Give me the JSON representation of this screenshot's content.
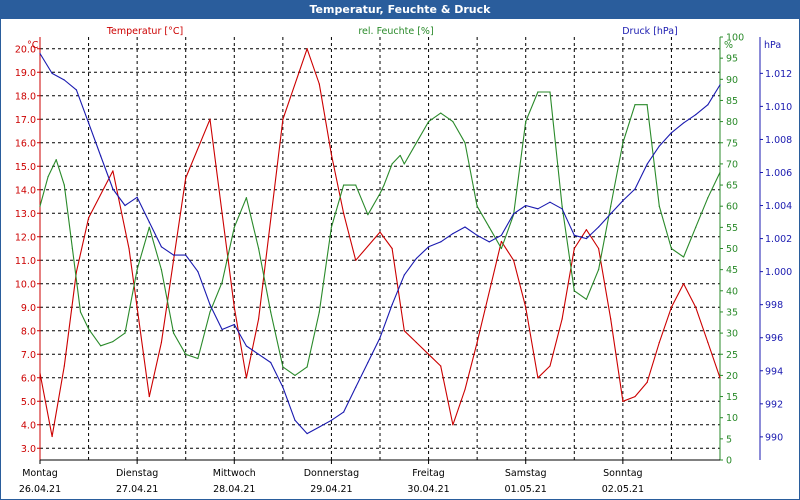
{
  "chart_data": {
    "type": "line",
    "title": "Temperatur, Feuchte & Druck",
    "x_range": [
      "2021-04-26 00:00",
      "2021-05-03 00:00"
    ],
    "x_ticks": [
      {
        "day": "Montag",
        "date": "26.04.21"
      },
      {
        "day": "Dienstag",
        "date": "27.04.21"
      },
      {
        "day": "Mittwoch",
        "date": "28.04.21"
      },
      {
        "day": "Donnerstag",
        "date": "29.04.21"
      },
      {
        "day": "Freitag",
        "date": "30.04.21"
      },
      {
        "day": "Samstag",
        "date": "01.05.21"
      },
      {
        "day": "Sonntag",
        "date": "02.05.21"
      }
    ],
    "grid": true,
    "axes": {
      "temperature": {
        "label": "Temperatur [°C]",
        "unit": "°C",
        "ylim": [
          2.5,
          20.5
        ],
        "ticks": [
          "20.0",
          "19.0",
          "18.0",
          "17.0",
          "16.0",
          "15.0",
          "14.0",
          "13.0",
          "12.0",
          "11.0",
          "10.0",
          "9.0",
          "8.0",
          "7.0",
          "6.0",
          "5.0",
          "4.0",
          "3.0"
        ],
        "color": "#cc0000"
      },
      "humidity": {
        "label": "rel. Feuchte [%]",
        "unit": "%",
        "ylim": [
          0,
          100
        ],
        "ticks": [
          "100",
          "95",
          "90",
          "85",
          "80",
          "75",
          "70",
          "65",
          "60",
          "55",
          "50",
          "45",
          "40",
          "35",
          "30",
          "25",
          "20",
          "15",
          "10",
          "5",
          "0"
        ],
        "color": "#2a8a2a"
      },
      "pressure": {
        "label": "Druck [hPa]",
        "unit": "hPa",
        "ylim": [
          988.6,
          1014.2
        ],
        "ticks": [
          "1.012",
          "1.010",
          "1.008",
          "1.006",
          "1.004",
          "1.002",
          "1.000",
          "998",
          "996",
          "994",
          "992",
          "990"
        ],
        "color": "#1a1ab0"
      }
    },
    "series": [
      {
        "name": "Temperatur [°C]",
        "axis": "temperature",
        "x_hours": [
          0,
          3,
          6,
          9,
          12,
          18,
          22,
          24,
          27,
          30,
          36,
          42,
          45,
          48,
          51,
          54,
          60,
          66,
          69,
          72,
          75,
          78,
          84,
          87,
          90,
          93,
          96,
          99,
          102,
          105,
          108,
          114,
          117,
          120,
          123,
          126,
          129,
          132,
          135,
          138,
          141,
          144,
          147,
          150,
          153,
          156,
          159,
          162,
          165,
          168
        ],
        "values": [
          6.2,
          3.5,
          6.5,
          10.5,
          12.8,
          14.8,
          11.5,
          9.0,
          5.2,
          7.5,
          14.5,
          17.0,
          13.0,
          9.0,
          6.0,
          8.5,
          17.0,
          20.0,
          18.5,
          15.5,
          13.0,
          11.0,
          12.2,
          11.5,
          8.0,
          7.5,
          7.0,
          6.5,
          4.0,
          5.5,
          7.5,
          11.8,
          11.0,
          9.0,
          6.0,
          6.5,
          8.5,
          11.5,
          12.3,
          11.5,
          8.5,
          5.0,
          5.2,
          5.8,
          7.5,
          9.0,
          10.0,
          9.0,
          7.5,
          6.0
        ]
      },
      {
        "name": "rel. Feuchte [%]",
        "axis": "humidity",
        "x_hours": [
          0,
          2,
          4,
          6,
          8,
          10,
          12,
          15,
          18,
          21,
          24,
          27,
          30,
          33,
          36,
          39,
          42,
          45,
          48,
          51,
          54,
          57,
          60,
          63,
          66,
          69,
          72,
          75,
          78,
          81,
          84,
          85,
          87,
          89,
          90,
          93,
          96,
          99,
          102,
          105,
          108,
          111,
          114,
          117,
          120,
          123,
          126,
          129,
          132,
          135,
          138,
          141,
          144,
          147,
          150,
          153,
          156,
          159,
          162,
          165,
          168
        ],
        "values": [
          60,
          67,
          71,
          65,
          50,
          35,
          31,
          27,
          28,
          30,
          45,
          55,
          45,
          30,
          25,
          24,
          35,
          42,
          55,
          62,
          50,
          35,
          22,
          20,
          22,
          35,
          55,
          65,
          65,
          58,
          63,
          65,
          70,
          72,
          70,
          75,
          80,
          82,
          80,
          75,
          60,
          55,
          50,
          58,
          80,
          87,
          87,
          60,
          40,
          38,
          45,
          60,
          75,
          84,
          84,
          60,
          50,
          48,
          55,
          62,
          68
        ]
      },
      {
        "name": "Druck [hPa]",
        "axis": "pressure",
        "x_hours": [
          0,
          3,
          6,
          9,
          12,
          15,
          18,
          21,
          24,
          27,
          30,
          33,
          36,
          39,
          42,
          45,
          48,
          51,
          54,
          57,
          60,
          63,
          66,
          69,
          72,
          75,
          78,
          81,
          84,
          87,
          90,
          93,
          96,
          99,
          102,
          105,
          108,
          111,
          114,
          117,
          120,
          123,
          126,
          129,
          132,
          135,
          138,
          141,
          144,
          147,
          150,
          153,
          156,
          159,
          162,
          165,
          168
        ],
        "values": [
          1013.2,
          1012.0,
          1011.6,
          1011.0,
          1009.0,
          1007.0,
          1005.0,
          1004.0,
          1004.5,
          1003.0,
          1001.5,
          1001.0,
          1001.0,
          1000.0,
          998.0,
          996.5,
          996.8,
          995.5,
          995.0,
          994.5,
          993.0,
          991.0,
          990.2,
          990.6,
          991.0,
          991.5,
          993.0,
          994.5,
          996.0,
          998.0,
          999.8,
          1000.8,
          1001.5,
          1001.8,
          1002.3,
          1002.7,
          1002.2,
          1001.8,
          1002.2,
          1003.5,
          1004.0,
          1003.8,
          1004.2,
          1003.8,
          1002.2,
          1002.0,
          1002.7,
          1003.5,
          1004.3,
          1005.0,
          1006.5,
          1007.6,
          1008.4,
          1009.0,
          1009.5,
          1010.1,
          1011.3
        ]
      }
    ]
  }
}
